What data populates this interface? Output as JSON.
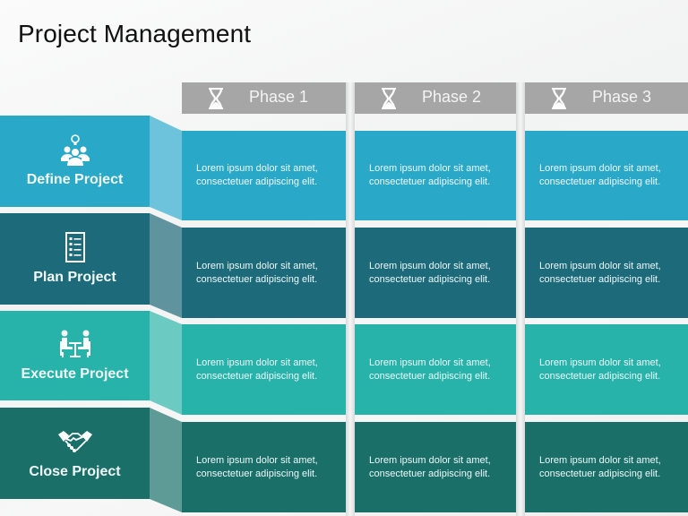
{
  "title": "Project Management",
  "phases": [
    {
      "label": "Phase 1",
      "icon": "hourglass-icon"
    },
    {
      "label": "Phase 2",
      "icon": "hourglass-icon"
    },
    {
      "label": "Phase 3",
      "icon": "hourglass-icon"
    }
  ],
  "rows": [
    {
      "name": "Define Project",
      "icon": "team-idea-icon",
      "color": "#2aa8c8",
      "fold_color": "#6cc3db",
      "cells": [
        {
          "line1": "Lorem ipsum dolor sit amet,",
          "line2": "consectetuer adipiscing elit."
        },
        {
          "line1": "Lorem ipsum dolor sit amet,",
          "line2": "consectetuer adipiscing elit."
        },
        {
          "line1": "Lorem ipsum dolor sit amet,",
          "line2": "consectetuer adipiscing elit."
        }
      ]
    },
    {
      "name": "Plan Project",
      "icon": "checklist-icon",
      "color": "#1c6a7a",
      "fold_color": "#5f939e",
      "cells": [
        {
          "line1": "Lorem ipsum dolor sit amet,",
          "line2": "consectetuer adipiscing elit."
        },
        {
          "line1": "Lorem ipsum dolor sit amet,",
          "line2": "consectetuer adipiscing elit."
        },
        {
          "line1": "Lorem ipsum dolor sit amet,",
          "line2": "consectetuer adipiscing elit."
        }
      ]
    },
    {
      "name": "Execute Project",
      "icon": "meeting-icon",
      "color": "#27b3a9",
      "fold_color": "#6bcbc3",
      "cells": [
        {
          "line1": "Lorem ipsum dolor sit amet,",
          "line2": "consectetuer adipiscing elit."
        },
        {
          "line1": "Lorem ipsum dolor sit amet,",
          "line2": "consectetuer adipiscing elit."
        },
        {
          "line1": "Lorem ipsum dolor sit amet,",
          "line2": "consectetuer adipiscing elit."
        }
      ]
    },
    {
      "name": "Close Project",
      "icon": "handshake-icon",
      "color": "#1a7069",
      "fold_color": "#5e9b96",
      "cells": [
        {
          "line1": "Lorem ipsum dolor sit amet,",
          "line2": "consectetuer adipiscing elit."
        },
        {
          "line1": "Lorem ipsum dolor sit amet,",
          "line2": "consectetuer adipiscing elit."
        },
        {
          "line1": "Lorem ipsum dolor sit amet,",
          "line2": "consectetuer adipiscing elit."
        }
      ]
    }
  ]
}
